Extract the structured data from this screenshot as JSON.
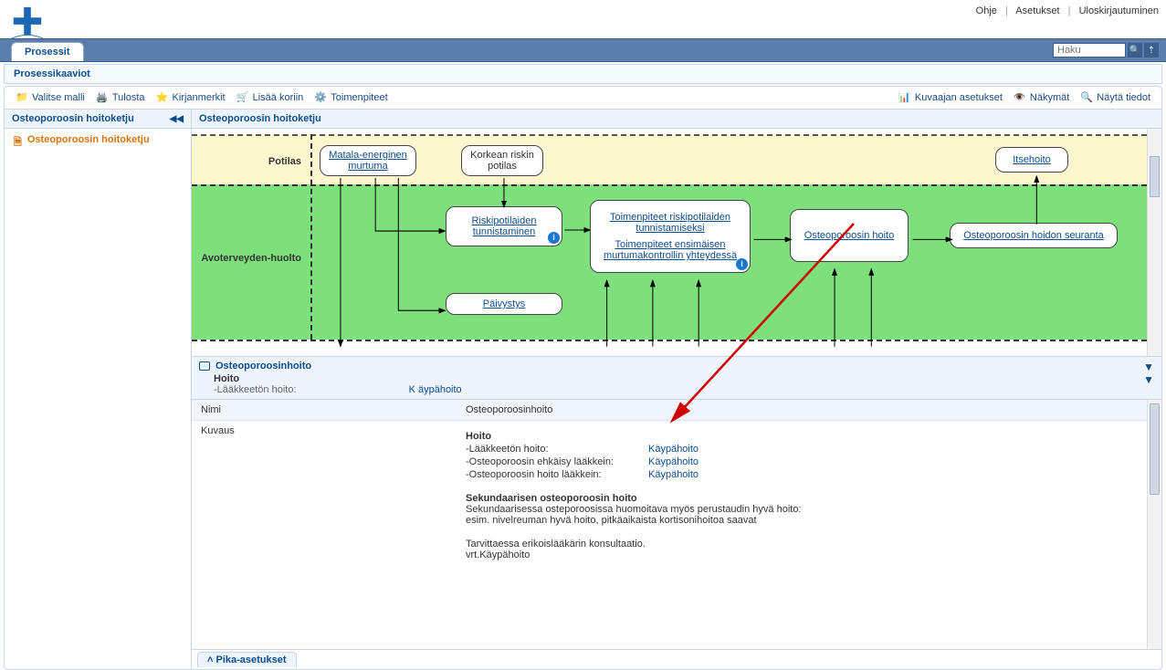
{
  "top_links": {
    "help": "Ohje",
    "settings": "Asetukset",
    "logout": "Uloskirjautuminen"
  },
  "tabs": {
    "processes": "Prosessit"
  },
  "search": {
    "placeholder": "Haku"
  },
  "subtitle": "Prosessikaaviot",
  "toolbar": {
    "select_template": "Valitse malli",
    "print": "Tulosta",
    "bookmarks": "Kirjanmerkit",
    "add_to_cart": "Lisää koriin",
    "actions": "Toimenpiteet",
    "graph_settings": "Kuvaajan asetukset",
    "views": "Näkymät",
    "show_info": "Näytä tiedot"
  },
  "left_pane": {
    "header": "Osteoporoosin hoitoketju",
    "tree_item": "Osteoporoosin hoitoketju"
  },
  "right_header": "Osteoporoosin hoitoketju",
  "lanes": {
    "patient": "Potilas",
    "outpatient": "Avoterveyden-huolto"
  },
  "boxes": {
    "low_energy": "Matala-energinen murtuma",
    "high_risk": "Korkean riskin potilas",
    "selfcare": "Itsehoito",
    "risk_id": "Riskipotilaiden tunnistaminen",
    "measures": "Toimenpiteet  riskipotilaiden tunnistamiseksi",
    "measures2": "Toimenpiteet ensimäisen murtumakontrollin yhteydessä",
    "treatment": "Osteoporoosin hoito",
    "followup": "Osteoporoosin hoidon seuranta",
    "oncall": "Päivystys"
  },
  "detail_panel": {
    "title": "Osteoporoosinhoito",
    "heading": "Hoito",
    "drugfree_label": "-Lääkkeetön hoito:",
    "kaypa": "K äypähoito"
  },
  "table": {
    "name_label": "Nimi",
    "name_value": "Osteoporoosinhoito",
    "desc_label": "Kuvaus",
    "desc": {
      "heading": "Hoito",
      "rows": [
        {
          "k": "-Lääkkeetön hoito:",
          "v": "Käypähoito"
        },
        {
          "k": "-Osteoporoosin ehkäisy lääkkein:",
          "v": "Käypähoito"
        },
        {
          "k": "-Osteoporoosin hoito lääkkein:",
          "v": "Käypähoito"
        }
      ],
      "sec_heading": "Sekundaarisen osteoporoosin hoito",
      "sec_p1": "Sekundaarisessa osteporoosissa huomoitava myös  perustaudin hyvä hoito:",
      "sec_p2": "esim. nivelreuman hyvä hoito, pitkäaikaista kortisonihoitoa saavat",
      "sec_p3": "Tarvittaessa erikoislääkärin konsultaatio.",
      "sec_p4": "vrt.Käypähoito"
    }
  },
  "footer": {
    "quick_settings": "Pika-asetukset"
  }
}
